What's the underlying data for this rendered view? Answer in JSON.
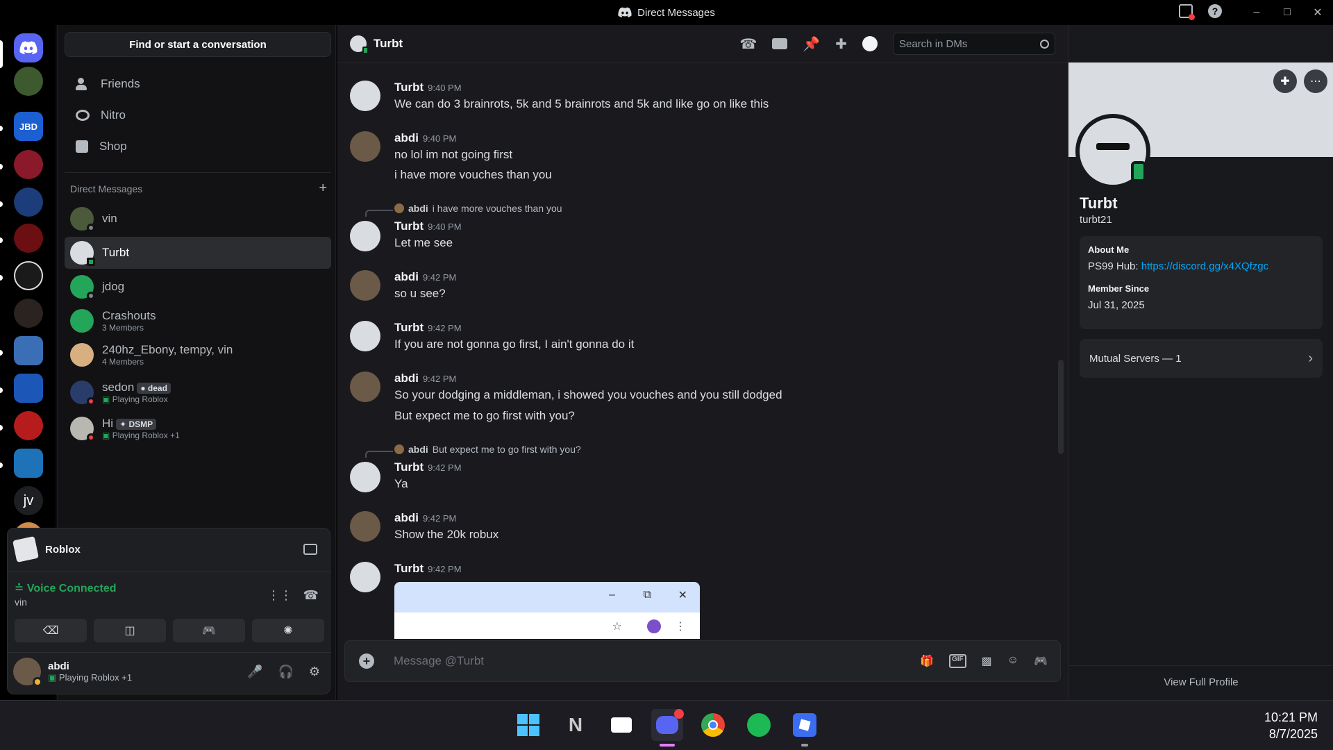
{
  "window": {
    "title": "Direct Messages"
  },
  "sidebar": {
    "search_label": "Find or start a conversation",
    "nav": [
      {
        "label": "Friends",
        "icon": "friends-icon"
      },
      {
        "label": "Nitro",
        "icon": "nitro-icon"
      },
      {
        "label": "Shop",
        "icon": "shop-icon"
      }
    ],
    "dm_header": "Direct Messages",
    "dms": [
      {
        "name": "vin",
        "sub": ""
      },
      {
        "name": "Turbt",
        "sub": ""
      },
      {
        "name": "jdog",
        "sub": ""
      },
      {
        "name": "Crashouts",
        "sub": "3 Members"
      },
      {
        "name": "240hz_Ebony, tempy, vin",
        "sub": "4 Members"
      },
      {
        "name": "sedon",
        "tag": "dead",
        "sub": "Playing Roblox"
      },
      {
        "name": "Hi",
        "tag": "DSMP",
        "sub": "Playing Roblox +1"
      }
    ]
  },
  "panel": {
    "activity": "Roblox",
    "voice_status": "Voice Connected",
    "voice_channel": "vin",
    "user_name": "abdi",
    "user_status": "Playing Roblox +1"
  },
  "chat": {
    "recipient": "Turbt",
    "search_placeholder": "Search in DMs",
    "composer_placeholder": "Message @Turbt",
    "messages": [
      {
        "author": "Turbt",
        "time": "9:40 PM",
        "lines": [
          "We can do 3 brainrots, 5k and 5 brainrots and 5k and like go on like this"
        ]
      },
      {
        "author": "abdi",
        "time": "9:40 PM",
        "lines": [
          "no lol im not going first",
          "i have more vouches than you"
        ]
      },
      {
        "author": "Turbt",
        "time": "9:40 PM",
        "reply_author": "abdi",
        "reply_text": "i have more vouches than you",
        "lines": [
          "Let me see"
        ]
      },
      {
        "author": "abdi",
        "time": "9:42 PM",
        "lines": [
          "so u see?"
        ]
      },
      {
        "author": "Turbt",
        "time": "9:42 PM",
        "lines": [
          "If you are not gonna go first, I ain't gonna do it"
        ]
      },
      {
        "author": "abdi",
        "time": "9:42 PM",
        "lines": [
          "So your dodging a middleman, i showed you vouches and you still dodged",
          "But expect me to go first with you?"
        ]
      },
      {
        "author": "Turbt",
        "time": "9:42 PM",
        "reply_author": "abdi",
        "reply_text": "But expect me to go first with you?",
        "lines": [
          "Ya"
        ]
      },
      {
        "author": "abdi",
        "time": "9:42 PM",
        "lines": [
          "Show the 20k robux"
        ]
      },
      {
        "author": "Turbt",
        "time": "9:42 PM",
        "lines": []
      }
    ]
  },
  "profile": {
    "display_name": "Turbt",
    "username": "turbt21",
    "about_label": "About Me",
    "about_prefix": "PS99 Hub: ",
    "about_link": "https://discord.gg/x4XQfzgc",
    "member_since_label": "Member Since",
    "member_since": "Jul 31, 2025",
    "mutual_servers": "Mutual Servers — 1",
    "view_full": "View Full Profile"
  },
  "rail": {
    "servers": [
      "JBD",
      "jv"
    ]
  },
  "taskbar": {
    "time": "10:21 PM",
    "date": "8/7/2025"
  },
  "colors": {
    "accent": "#5865f2",
    "online": "#23a55a",
    "dnd": "#f23f43",
    "link": "#00a8fc"
  }
}
